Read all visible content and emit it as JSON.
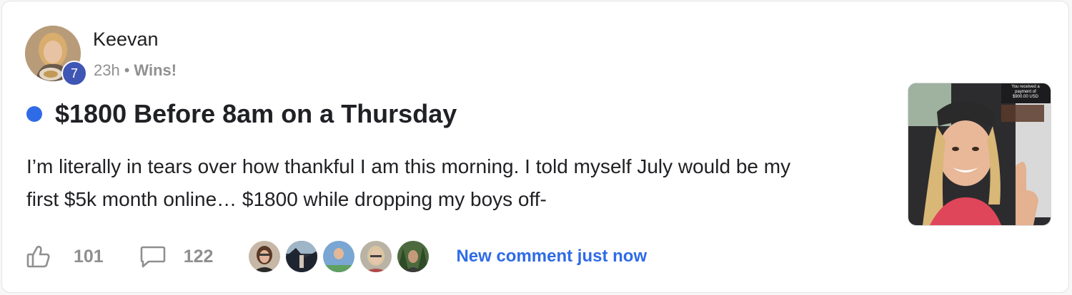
{
  "post": {
    "author": "Keevan",
    "level": "7",
    "time": "23h",
    "separator": "•",
    "category": "Wins!",
    "title": "$1800 Before 8am on a Thursday",
    "body_line1": "I’m literally in tears over how thankful I am this morning. I told myself July would be my",
    "body_line2": "first $5k month online… $1800 while dropping my boys off-",
    "thumbnail": {
      "overlay_line1": "You received a",
      "overlay_line2": "payment of",
      "overlay_line3": "$900.00 USD"
    }
  },
  "footer": {
    "like_icon": "thumbs-up-icon",
    "like_count": "101",
    "comment_icon": "comment-bubble-icon",
    "comment_count": "122",
    "commenter_avatars": [
      "commenter-1",
      "commenter-2",
      "commenter-3",
      "commenter-4",
      "commenter-5"
    ],
    "new_comment_label": "New comment just now"
  },
  "colors": {
    "accent": "#2f6be6",
    "level_badge": "#3f56b5",
    "muted_text": "#909090"
  }
}
